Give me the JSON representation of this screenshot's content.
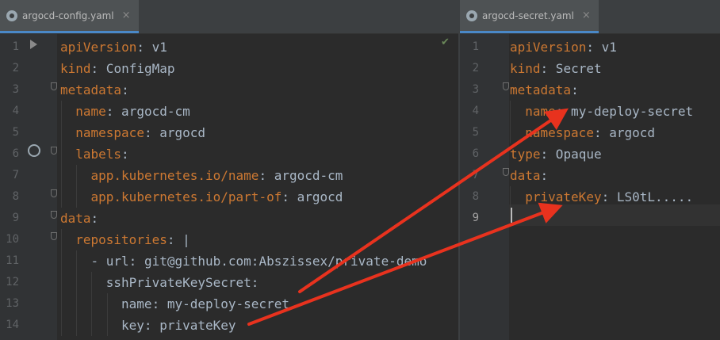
{
  "left_pane": {
    "tab": {
      "label": "argocd-config.yaml",
      "close": "×"
    },
    "lines": [
      {
        "n": "1",
        "indent": 0,
        "key": "apiVersion",
        "value": " v1"
      },
      {
        "n": "2",
        "indent": 0,
        "key": "kind",
        "value": " ConfigMap"
      },
      {
        "n": "3",
        "indent": 0,
        "key": "metadata",
        "value": ""
      },
      {
        "n": "4",
        "indent": 2,
        "key": "name",
        "value": " argocd-cm"
      },
      {
        "n": "5",
        "indent": 2,
        "key": "namespace",
        "value": " argocd"
      },
      {
        "n": "6",
        "indent": 2,
        "key": "labels",
        "value": ""
      },
      {
        "n": "7",
        "indent": 4,
        "key": "app.kubernetes.io/name",
        "value": " argocd-cm"
      },
      {
        "n": "8",
        "indent": 4,
        "key": "app.kubernetes.io/part-of",
        "value": " argocd"
      },
      {
        "n": "9",
        "indent": 0,
        "key": "data",
        "value": ""
      },
      {
        "n": "10",
        "indent": 2,
        "key": "repositories",
        "value": " |"
      },
      {
        "n": "11",
        "indent": 4,
        "key": "",
        "value": "- url: git@github.com:Abszissex/private-demo"
      },
      {
        "n": "12",
        "indent": 6,
        "key": "",
        "value": "sshPrivateKeySecret:"
      },
      {
        "n": "13",
        "indent": 8,
        "key": "",
        "value": "name: my-deploy-secret"
      },
      {
        "n": "14",
        "indent": 8,
        "key": "",
        "value": "key: privateKey"
      }
    ]
  },
  "right_pane": {
    "tab": {
      "label": "argocd-secret.yaml",
      "close": "×"
    },
    "lines": [
      {
        "n": "1",
        "indent": 0,
        "key": "apiVersion",
        "value": " v1"
      },
      {
        "n": "2",
        "indent": 0,
        "key": "kind",
        "value": " Secret"
      },
      {
        "n": "3",
        "indent": 0,
        "key": "metadata",
        "value": ""
      },
      {
        "n": "4",
        "indent": 2,
        "key": "name",
        "value": " my-deploy-secret"
      },
      {
        "n": "5",
        "indent": 2,
        "key": "namespace",
        "value": " argocd"
      },
      {
        "n": "6",
        "indent": 0,
        "key": "type",
        "value": " Opaque"
      },
      {
        "n": "7",
        "indent": 0,
        "key": "data",
        "value": ""
      },
      {
        "n": "8",
        "indent": 2,
        "key": "privateKey",
        "value": " LS0tL....."
      },
      {
        "n": "9",
        "indent": 0,
        "key": "",
        "value": ""
      }
    ]
  },
  "icons": {
    "run": "run-icon",
    "kubernetes": "kubernetes-icon",
    "check": "check-icon",
    "file": "yaml-file-icon"
  },
  "colors": {
    "key": "#cc7832",
    "value": "#a9b7c6",
    "arrow": "#e8321e"
  }
}
